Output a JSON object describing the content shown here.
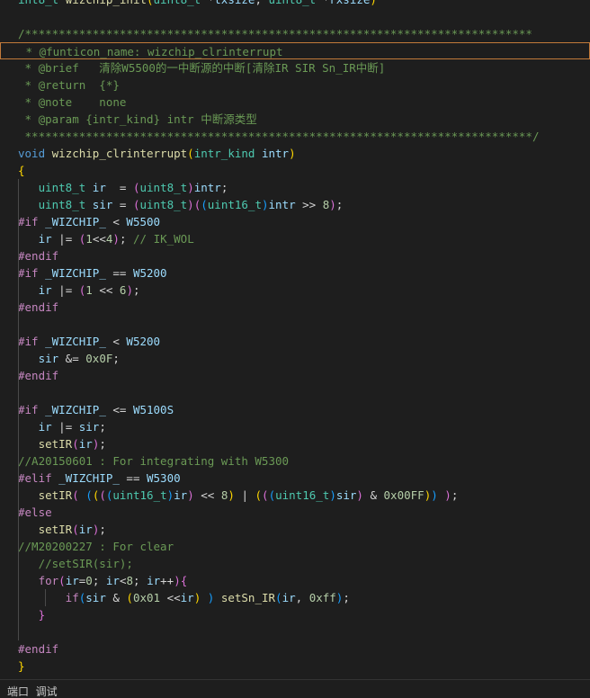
{
  "colors": {
    "background": "#1e1e1e",
    "keyword": "#569cd6",
    "type": "#4ec9b0",
    "function": "#dcdcaa",
    "variable": "#9cdcfe",
    "number": "#b5cea8",
    "comment": "#6a9955",
    "preprocessor": "#c586c0",
    "plain": "#d4d4d4",
    "current_line_border": "#c27a3a"
  },
  "editor": {
    "highlighted_line": 3,
    "lines": [
      [
        [
          "int8_t ",
          "ty"
        ],
        [
          "wizchip_init",
          "fn"
        ],
        [
          "(",
          "br1"
        ],
        [
          "uint8_t",
          "ty"
        ],
        [
          " *",
          "def"
        ],
        [
          "txsize",
          "var"
        ],
        [
          ", ",
          "def"
        ],
        [
          "uint8_t",
          "ty"
        ],
        [
          " *",
          "def"
        ],
        [
          "rxsize",
          "var"
        ],
        [
          ")",
          "br1"
        ]
      ],
      [],
      [
        [
          "/***************************************************************************",
          "com"
        ]
      ],
      [
        [
          " * @funticon_name: wizchip_clrinterrupt",
          "com"
        ]
      ],
      [
        [
          " * @brief   清除W5500的一中断源的中断[清除IR SIR Sn_IR中断]",
          "com"
        ]
      ],
      [
        [
          " * @return  {*}",
          "com"
        ]
      ],
      [
        [
          " * @note    none",
          "com"
        ]
      ],
      [
        [
          " * @param {intr_kind} intr 中断源类型",
          "com"
        ]
      ],
      [
        [
          " ***************************************************************************/",
          "com"
        ]
      ],
      [
        [
          "void ",
          "kw"
        ],
        [
          "wizchip_clrinterrupt",
          "fn"
        ],
        [
          "(",
          "br1"
        ],
        [
          "intr_kind ",
          "ty"
        ],
        [
          "intr",
          "var"
        ],
        [
          ")",
          "br1"
        ]
      ],
      [
        [
          "{",
          "br1"
        ]
      ],
      [
        [
          "   uint8_t ",
          "ty"
        ],
        [
          "ir",
          "var"
        ],
        [
          "  = ",
          "def"
        ],
        [
          "(",
          "br2"
        ],
        [
          "uint8_t",
          "ty"
        ],
        [
          ")",
          "br2"
        ],
        [
          "intr",
          "var"
        ],
        [
          ";",
          "def"
        ]
      ],
      [
        [
          "   uint8_t ",
          "ty"
        ],
        [
          "sir",
          "var"
        ],
        [
          " = ",
          "def"
        ],
        [
          "(",
          "br2"
        ],
        [
          "uint8_t",
          "ty"
        ],
        [
          ")",
          "br2"
        ],
        [
          "(",
          "br2"
        ],
        [
          "(",
          "br3"
        ],
        [
          "uint16_t",
          "ty"
        ],
        [
          ")",
          "br3"
        ],
        [
          "intr",
          "var"
        ],
        [
          " >> ",
          "def"
        ],
        [
          "8",
          "num"
        ],
        [
          ")",
          "br2"
        ],
        [
          ";",
          "def"
        ]
      ],
      [
        [
          "#if ",
          "pp"
        ],
        [
          "_WIZCHIP_",
          "var"
        ],
        [
          " < ",
          "def"
        ],
        [
          "W5500",
          "var"
        ]
      ],
      [
        [
          "   ir",
          "var"
        ],
        [
          " |= ",
          "def"
        ],
        [
          "(",
          "br2"
        ],
        [
          "1",
          "num"
        ],
        [
          "<<",
          "def"
        ],
        [
          "4",
          "num"
        ],
        [
          ")",
          "br2"
        ],
        [
          "; ",
          "def"
        ],
        [
          "// IK_WOL",
          "com"
        ]
      ],
      [
        [
          "#endif",
          "pp"
        ]
      ],
      [
        [
          "#if ",
          "pp"
        ],
        [
          "_WIZCHIP_",
          "var"
        ],
        [
          " == ",
          "def"
        ],
        [
          "W5200",
          "var"
        ]
      ],
      [
        [
          "   ir",
          "var"
        ],
        [
          " |= ",
          "def"
        ],
        [
          "(",
          "br2"
        ],
        [
          "1",
          "num"
        ],
        [
          " << ",
          "def"
        ],
        [
          "6",
          "num"
        ],
        [
          ")",
          "br2"
        ],
        [
          ";",
          "def"
        ]
      ],
      [
        [
          "#endif",
          "pp"
        ]
      ],
      [],
      [
        [
          "#if ",
          "pp"
        ],
        [
          "_WIZCHIP_",
          "var"
        ],
        [
          " < ",
          "def"
        ],
        [
          "W5200",
          "var"
        ]
      ],
      [
        [
          "   sir",
          "var"
        ],
        [
          " &= ",
          "def"
        ],
        [
          "0x0F",
          "num"
        ],
        [
          ";",
          "def"
        ]
      ],
      [
        [
          "#endif",
          "pp"
        ]
      ],
      [],
      [
        [
          "#if ",
          "pp"
        ],
        [
          "_WIZCHIP_",
          "var"
        ],
        [
          " <= ",
          "def"
        ],
        [
          "W5100S",
          "var"
        ]
      ],
      [
        [
          "   ir",
          "var"
        ],
        [
          " |= ",
          "def"
        ],
        [
          "sir",
          "var"
        ],
        [
          ";",
          "def"
        ]
      ],
      [
        [
          "   setIR",
          "fn"
        ],
        [
          "(",
          "br2"
        ],
        [
          "ir",
          "var"
        ],
        [
          ")",
          "br2"
        ],
        [
          ";",
          "def"
        ]
      ],
      [
        [
          "//A20150601 : For integrating with W5300",
          "com"
        ]
      ],
      [
        [
          "#elif ",
          "pp"
        ],
        [
          "_WIZCHIP_",
          "var"
        ],
        [
          " == ",
          "def"
        ],
        [
          "W5300",
          "var"
        ]
      ],
      [
        [
          "   setIR",
          "fn"
        ],
        [
          "(",
          "br2"
        ],
        [
          " ",
          "def"
        ],
        [
          "(",
          "br3"
        ],
        [
          "(",
          "br1"
        ],
        [
          "(",
          "br2"
        ],
        [
          "(",
          "br3"
        ],
        [
          "uint16_t",
          "ty"
        ],
        [
          ")",
          "br3"
        ],
        [
          "ir",
          "var"
        ],
        [
          ")",
          "br2"
        ],
        [
          " << ",
          "def"
        ],
        [
          "8",
          "num"
        ],
        [
          ")",
          "br1"
        ],
        [
          " | ",
          "def"
        ],
        [
          "(",
          "br1"
        ],
        [
          "(",
          "br2"
        ],
        [
          "(",
          "br3"
        ],
        [
          "uint16_t",
          "ty"
        ],
        [
          ")",
          "br3"
        ],
        [
          "sir",
          "var"
        ],
        [
          ")",
          "br2"
        ],
        [
          " & ",
          "def"
        ],
        [
          "0x00FF",
          "num"
        ],
        [
          ")",
          "br1"
        ],
        [
          ")",
          "br3"
        ],
        [
          " ",
          "def"
        ],
        [
          ")",
          "br2"
        ],
        [
          ";",
          "def"
        ]
      ],
      [
        [
          "#else",
          "pp"
        ]
      ],
      [
        [
          "   setIR",
          "fn"
        ],
        [
          "(",
          "br2"
        ],
        [
          "ir",
          "var"
        ],
        [
          ")",
          "br2"
        ],
        [
          ";",
          "def"
        ]
      ],
      [
        [
          "//M20200227 : For clear",
          "com"
        ]
      ],
      [
        [
          "   //setSIR(sir);",
          "com"
        ]
      ],
      [
        [
          "   for",
          "pp"
        ],
        [
          "(",
          "br2"
        ],
        [
          "ir",
          "var"
        ],
        [
          "=",
          "def"
        ],
        [
          "0",
          "num"
        ],
        [
          "; ",
          "def"
        ],
        [
          "ir",
          "var"
        ],
        [
          "<",
          "def"
        ],
        [
          "8",
          "num"
        ],
        [
          "; ",
          "def"
        ],
        [
          "ir",
          "var"
        ],
        [
          "++",
          "def"
        ],
        [
          ")",
          "br2"
        ],
        [
          "{",
          "br2"
        ]
      ],
      [
        [
          "       if",
          "pp"
        ],
        [
          "(",
          "br3"
        ],
        [
          "sir",
          "var"
        ],
        [
          " & ",
          "def"
        ],
        [
          "(",
          "br1"
        ],
        [
          "0x01",
          "num"
        ],
        [
          " <<",
          "def"
        ],
        [
          "ir",
          "var"
        ],
        [
          ")",
          "br1"
        ],
        [
          " ) ",
          "br3"
        ],
        [
          "setSn_IR",
          "fn"
        ],
        [
          "(",
          "br3"
        ],
        [
          "ir",
          "var"
        ],
        [
          ", ",
          "def"
        ],
        [
          "0xff",
          "num"
        ],
        [
          ")",
          "br3"
        ],
        [
          ";",
          "def"
        ]
      ],
      [
        [
          "   }",
          "br2"
        ]
      ],
      [],
      [
        [
          "#endif",
          "pp"
        ]
      ],
      [
        [
          "}",
          "br1"
        ]
      ]
    ]
  },
  "guides": [
    {
      "col": 0,
      "from": 11,
      "to": 38
    },
    {
      "col": 4,
      "from": 35,
      "to": 36
    }
  ],
  "statusbar": {
    "text": "端口  调试"
  }
}
